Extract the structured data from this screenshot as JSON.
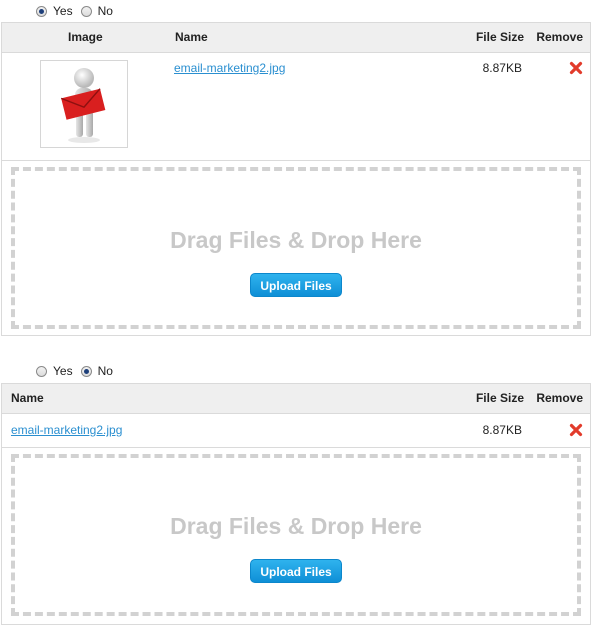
{
  "section1": {
    "radio": {
      "yes_label": "Yes",
      "no_label": "No",
      "selected": "Yes"
    },
    "table": {
      "headers": {
        "image": "Image",
        "name": "Name",
        "file_size": "File Size",
        "remove": "Remove"
      },
      "rows": [
        {
          "name": "email-marketing2.jpg",
          "file_size": "8.87KB"
        }
      ]
    },
    "dropzone": {
      "text": "Drag Files & Drop Here",
      "button_label": "Upload Files"
    }
  },
  "section2": {
    "radio": {
      "yes_label": "Yes",
      "no_label": "No",
      "selected": "No"
    },
    "table": {
      "headers": {
        "name": "Name",
        "file_size": "File Size",
        "remove": "Remove"
      },
      "rows": [
        {
          "name": "email-marketing2.jpg",
          "file_size": "8.87KB"
        }
      ]
    },
    "dropzone": {
      "text": "Drag Files & Drop Here",
      "button_label": "Upload Files"
    }
  },
  "colors": {
    "link": "#2a8fd0",
    "remove": "#e23b2b",
    "button": "#1ea3e4",
    "header_bg": "#efefef",
    "dropzone_border": "#d2d2d2",
    "drop_text": "#c8c8c8"
  },
  "icons": {
    "remove": "red-x-icon",
    "thumbnail": "person-holding-envelope-image"
  }
}
